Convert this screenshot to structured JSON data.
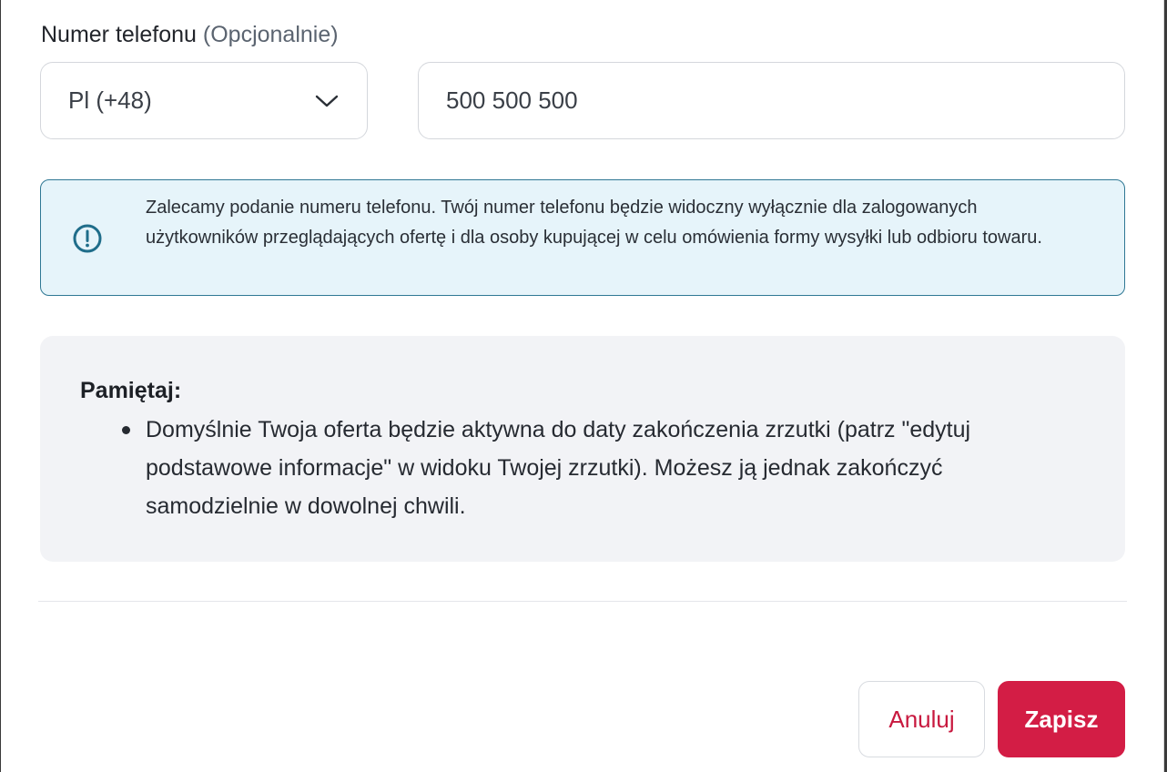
{
  "phone": {
    "label": "Numer telefonu",
    "optional_label": "(Opcjonalnie)",
    "country_code_value": "Pl (+48)",
    "number_value": "500 500 500"
  },
  "info": {
    "text": "Zalecamy podanie numeru telefonu. Twój numer telefonu będzie widoczny wyłącznie dla zalogowanych użytkowników przeglądających ofertę i dla osoby kupującej w celu omówienia formy wysyłki lub odbioru towaru."
  },
  "note": {
    "title": "Pamiętaj:",
    "items": [
      "Domyślnie Twoja oferta będzie aktywna do daty zakończenia zrzutki (patrz \"edytuj podstawowe informacje\" w widoku Twojej zrzutki). Możesz ją jednak zakończyć samodzielnie w dowolnej chwili."
    ]
  },
  "actions": {
    "cancel_label": "Anuluj",
    "save_label": "Zapisz"
  },
  "icons": {
    "info": "exclamation-circle-icon",
    "dropdown": "chevron-down-icon"
  },
  "colors": {
    "accent": "#d31d45",
    "info_border": "#2f7894",
    "info_background": "#e6f4fa",
    "note_background": "#f2f3f6"
  }
}
